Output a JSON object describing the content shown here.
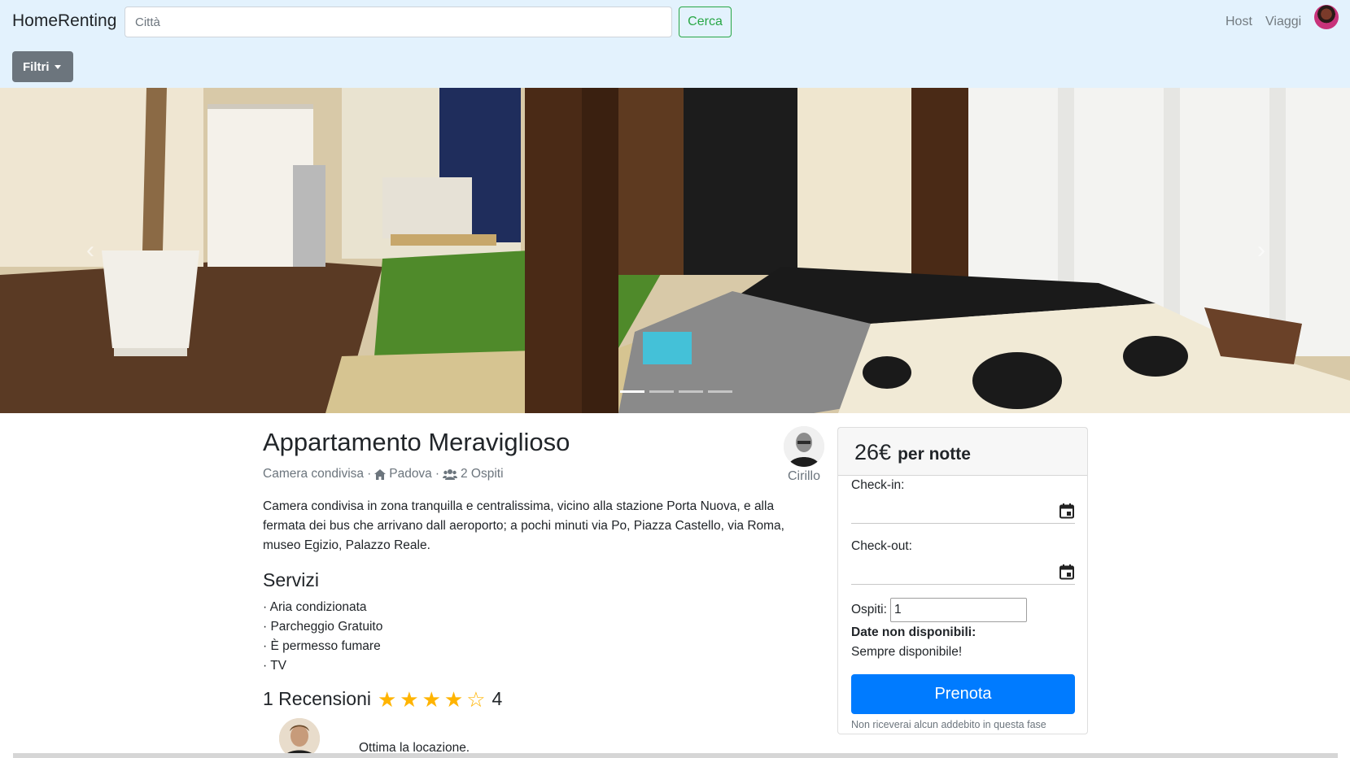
{
  "navbar": {
    "brand": "HomeRenting",
    "search_placeholder": "Città",
    "search_button": "Cerca",
    "links": [
      "Host",
      "Viaggi"
    ],
    "filter_button": "Filtri"
  },
  "carousel": {
    "slide_count": 4,
    "active_slide": 1
  },
  "listing": {
    "title": "Appartamento Meraviglioso",
    "type": "Camera condivisa",
    "city": "Padova",
    "guests": "2 Ospiti",
    "separator": "·",
    "host_name": "Cirillo",
    "description": "Camera condivisa in zona tranquilla e centralissima, vicino alla stazione Porta Nuova, e alla fermata dei bus che arrivano dall aeroporto; a pochi minuti via Po, Piazza Castello, via Roma, museo Egizio, Palazzo Reale.",
    "services_title": "Servizi",
    "services": [
      "· Aria condizionata",
      "· Parcheggio Gratuito",
      "· È permesso fumare",
      "· TV"
    ]
  },
  "reviews": {
    "header": "1 Recensioni",
    "rating": 4,
    "max_rating": 5,
    "rating_label": "4",
    "items": [
      {
        "text": "Ottima la locazione."
      }
    ]
  },
  "booking": {
    "price": "26€",
    "per_night": "per notte",
    "checkin_label": "Check-in:",
    "checkout_label": "Check-out:",
    "guests_label": "Ospiti:",
    "guests_value": "1",
    "unavailable_label": "Date non disponibili:",
    "unavailable_value": "Sempre disponibile!",
    "book_button": "Prenota",
    "note": "Non riceverai alcun addebito in questa fase"
  },
  "colors": {
    "navbar_bg": "#e3f2fd",
    "success": "#28a745",
    "secondary": "#6c757d",
    "primary": "#007bff",
    "star": "#ffb400"
  }
}
